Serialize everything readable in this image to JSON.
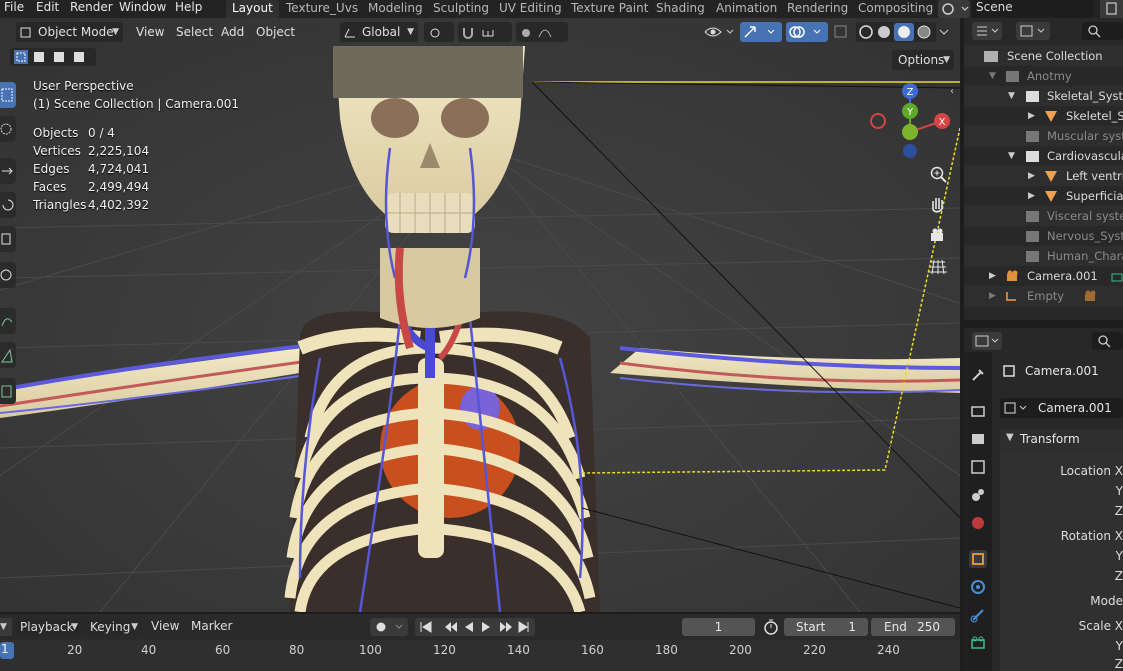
{
  "menu": [
    "File",
    "Edit",
    "Render",
    "Window",
    "Help"
  ],
  "workspaces": [
    {
      "label": "Layout",
      "active": true
    },
    {
      "label": "Texture_Uvs"
    },
    {
      "label": "Modeling"
    },
    {
      "label": "Sculpting"
    },
    {
      "label": "UV Editing"
    },
    {
      "label": "Texture Paint"
    },
    {
      "label": "Shading"
    },
    {
      "label": "Animation"
    },
    {
      "label": "Rendering"
    },
    {
      "label": "Compositing"
    }
  ],
  "scene_name": "Scene",
  "viewport_header": {
    "mode": "Object Mode",
    "menus": [
      "View",
      "Select",
      "Add",
      "Object"
    ],
    "orientation": "Global",
    "options": "Options"
  },
  "overlay": {
    "perspective": "User Perspective",
    "collection": "(1) Scene Collection | Camera.001",
    "stats": [
      {
        "label": "Objects",
        "value": "0 / 4"
      },
      {
        "label": "Vertices",
        "value": "2,225,104"
      },
      {
        "label": "Edges",
        "value": "4,724,041"
      },
      {
        "label": "Faces",
        "value": "2,499,494"
      },
      {
        "label": "Triangles",
        "value": "4,402,392"
      }
    ]
  },
  "gizmo": {
    "z": "Z",
    "y": "Y",
    "x": "X"
  },
  "outliner": {
    "rows": [
      {
        "label": "Scene Collection",
        "dim": false
      },
      {
        "label": "Anotmy",
        "dim": true
      },
      {
        "label": "Skeletal_Systen",
        "dim": false
      },
      {
        "label": "Skeletel_Sy",
        "dim": false
      },
      {
        "label": "Muscular system",
        "dim": true
      },
      {
        "label": "Cardiovascular",
        "dim": false
      },
      {
        "label": "Left ventric",
        "dim": false
      },
      {
        "label": "Superficial",
        "dim": false
      },
      {
        "label": "Visceral system",
        "dim": true
      },
      {
        "label": "Nervous_System",
        "dim": true
      },
      {
        "label": "Human_Charac",
        "dim": true
      },
      {
        "label": "Camera.001",
        "dim": false
      },
      {
        "label": "Empty",
        "dim": true
      }
    ]
  },
  "properties": {
    "object_name": "Camera.001",
    "data_name": "Camera.001",
    "panel": "Transform",
    "fields": [
      "Location X",
      "Y",
      "Z",
      "Rotation X",
      "Y",
      "Z",
      "Mode",
      "Scale X",
      "Y",
      "Z"
    ]
  },
  "timeline": {
    "menus": [
      "Playback",
      "Keying",
      "View",
      "Marker"
    ],
    "current_frame": "1",
    "start_label": "Start",
    "start": "1",
    "end_label": "End",
    "end": "250",
    "ruler": [
      "1",
      "20",
      "40",
      "60",
      "80",
      "100",
      "120",
      "140",
      "160",
      "180",
      "200",
      "220",
      "240"
    ]
  }
}
